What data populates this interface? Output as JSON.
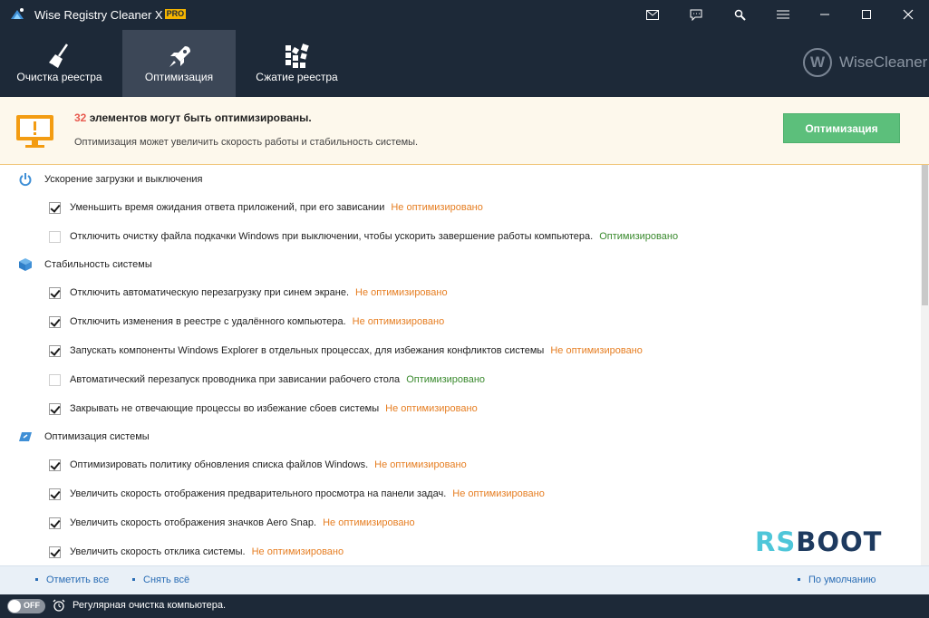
{
  "app": {
    "title": "Wise Registry Cleaner X",
    "badge": "PRO"
  },
  "tabs": [
    {
      "label": "Очистка реестра"
    },
    {
      "label": "Оптимизация",
      "active": true
    },
    {
      "label": "Сжатие реестра"
    }
  ],
  "brand": {
    "initial": "W",
    "name": "WiseCleaner"
  },
  "banner": {
    "count": "32",
    "title_rest": " элементов могут быть оптимизированы.",
    "subtitle": "Оптимизация может увеличить скорость работы и стабильность системы.",
    "button": "Оптимизация"
  },
  "sections": [
    {
      "label": "Ускорение загрузки и выключения",
      "icon": "power-icon",
      "items": [
        {
          "text": "Уменьшить время ожидания ответа приложений, при его зависании",
          "status": "Не оптимизировано",
          "checked": true
        },
        {
          "text": "Отключить очистку файла подкачки Windows при выключении, чтобы ускорить завершение работы компьютера.",
          "status": "Оптимизировано",
          "checked": false
        }
      ]
    },
    {
      "label": "Стабильность системы",
      "icon": "cube-icon",
      "items": [
        {
          "text": "Отключить автоматическую перезагрузку при синем экране.",
          "status": "Не оптимизировано",
          "checked": true
        },
        {
          "text": "Отключить изменения в реестре с удалённого компьютера.",
          "status": "Не оптимизировано",
          "checked": true
        },
        {
          "text": "Запускать компоненты Windows Explorer в отдельных процессах, для избежания конфликтов системы",
          "status": "Не оптимизировано",
          "checked": true
        },
        {
          "text": "Автоматический перезапуск проводника при зависании рабочего стола",
          "status": "Оптимизировано",
          "checked": false
        },
        {
          "text": "Закрывать не отвечающие процессы во избежание сбоев системы",
          "status": "Не оптимизировано",
          "checked": true
        }
      ]
    },
    {
      "label": "Оптимизация системы",
      "icon": "speed-icon",
      "items": [
        {
          "text": "Оптимизировать политику обновления списка файлов Windows.",
          "status": "Не оптимизировано",
          "checked": true
        },
        {
          "text": "Увеличить скорость отображения предварительного просмотра на панели задач.",
          "status": "Не оптимизировано",
          "checked": true
        },
        {
          "text": "Увеличить скорость отображения значков Aero Snap.",
          "status": "Не оптимизировано",
          "checked": true
        },
        {
          "text": "Увеличить скорость отклика системы.",
          "status": "Не оптимизировано",
          "checked": true
        }
      ]
    }
  ],
  "watermark": {
    "part1": "RS",
    "part2": "BOOT"
  },
  "actions": {
    "select_all": "Отметить все",
    "deselect_all": "Снять всё",
    "default": "По умолчанию"
  },
  "status": {
    "toggle": "OFF",
    "text": "Регулярная очистка компьютера."
  },
  "colors": {
    "header": "#1d2938",
    "accent_green": "#5cbf7b",
    "not_optimized": "#e67e22",
    "optimized": "#3a8a2e",
    "count": "#e85a4f"
  }
}
